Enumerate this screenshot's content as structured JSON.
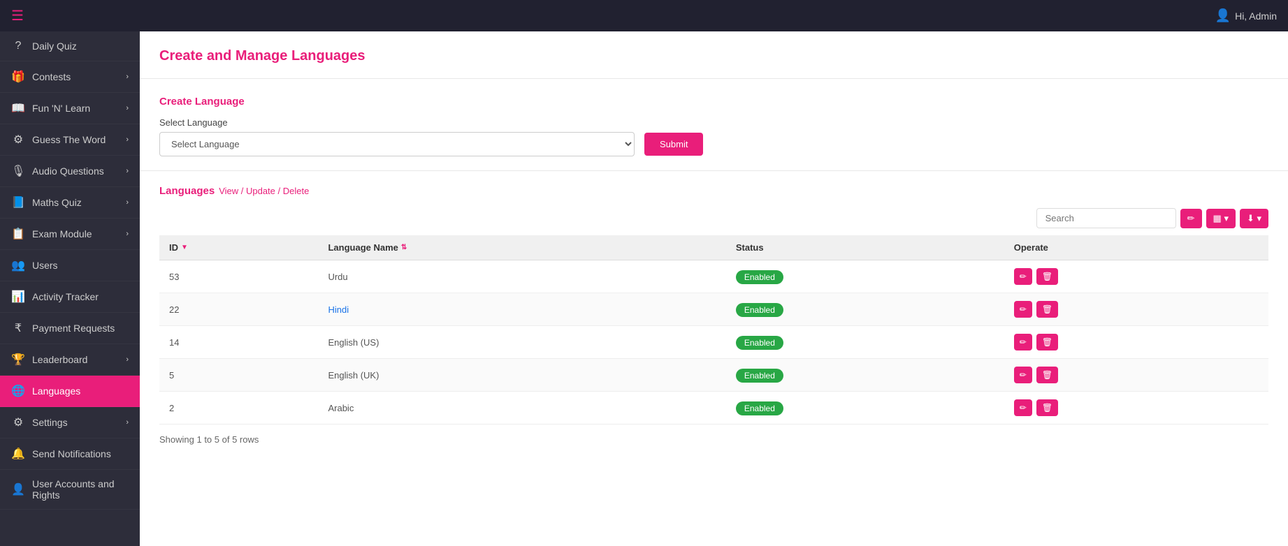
{
  "topbar": {
    "hamburger_label": "☰",
    "user_greeting": "Hi, Admin"
  },
  "sidebar": {
    "items": [
      {
        "id": "daily-quiz",
        "label": "Daily Quiz",
        "icon": "?",
        "active": false,
        "has_arrow": false
      },
      {
        "id": "contests",
        "label": "Contests",
        "icon": "🎁",
        "active": false,
        "has_arrow": true
      },
      {
        "id": "fun-learn",
        "label": "Fun 'N' Learn",
        "icon": "📖",
        "active": false,
        "has_arrow": true
      },
      {
        "id": "guess-the-word",
        "label": "Guess The Word",
        "icon": "⚙",
        "active": false,
        "has_arrow": true
      },
      {
        "id": "audio-questions",
        "label": "Audio Questions",
        "icon": "🎙",
        "active": false,
        "has_arrow": true
      },
      {
        "id": "maths-quiz",
        "label": "Maths Quiz",
        "icon": "📘",
        "active": false,
        "has_arrow": true
      },
      {
        "id": "exam-module",
        "label": "Exam Module",
        "icon": "📋",
        "active": false,
        "has_arrow": true
      },
      {
        "id": "users",
        "label": "Users",
        "icon": "👥",
        "active": false,
        "has_arrow": false
      },
      {
        "id": "activity-tracker",
        "label": "Activity Tracker",
        "icon": "📊",
        "active": false,
        "has_arrow": false
      },
      {
        "id": "payment-requests",
        "label": "Payment Requests",
        "icon": "₹",
        "active": false,
        "has_arrow": false
      },
      {
        "id": "leaderboard",
        "label": "Leaderboard",
        "icon": "🏆",
        "active": false,
        "has_arrow": true
      },
      {
        "id": "languages",
        "label": "Languages",
        "icon": "🌐",
        "active": true,
        "has_arrow": false
      },
      {
        "id": "settings",
        "label": "Settings",
        "icon": "⚙",
        "active": false,
        "has_arrow": true
      },
      {
        "id": "send-notifications",
        "label": "Send Notifications",
        "icon": "🔔",
        "active": false,
        "has_arrow": false
      },
      {
        "id": "user-accounts",
        "label": "User Accounts and Rights",
        "icon": "👤",
        "active": false,
        "has_arrow": false
      }
    ]
  },
  "page": {
    "title": "Create and Manage Languages",
    "create_section_title": "Create Language",
    "select_label": "Select Language",
    "select_placeholder": "Select Language",
    "submit_button": "Submit",
    "languages_section_title": "Languages",
    "languages_section_subtitle": "View / Update / Delete",
    "search_placeholder": "Search",
    "showing_rows": "Showing 1 to 5 of 5 rows"
  },
  "table": {
    "columns": [
      {
        "key": "id",
        "label": "ID"
      },
      {
        "key": "language_name",
        "label": "Language Name"
      },
      {
        "key": "status",
        "label": "Status"
      },
      {
        "key": "operate",
        "label": "Operate"
      }
    ],
    "rows": [
      {
        "id": "53",
        "language_name": "Urdu",
        "status": "Enabled",
        "is_link": false
      },
      {
        "id": "22",
        "language_name": "Hindi",
        "status": "Enabled",
        "is_link": true
      },
      {
        "id": "14",
        "language_name": "English (US)",
        "status": "Enabled",
        "is_link": false
      },
      {
        "id": "5",
        "language_name": "English (UK)",
        "status": "Enabled",
        "is_link": false
      },
      {
        "id": "2",
        "language_name": "Arabic",
        "status": "Enabled",
        "is_link": false
      }
    ]
  }
}
